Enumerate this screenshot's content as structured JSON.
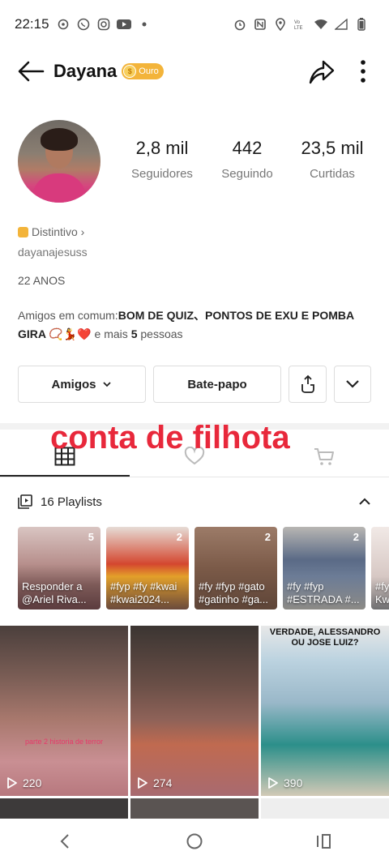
{
  "status_bar": {
    "time": "22:15"
  },
  "header": {
    "username": "Dayana",
    "badge_label": "Ouro",
    "badge_coin": "$"
  },
  "stats": [
    {
      "value": "2,8 mil",
      "label": "Seguidores"
    },
    {
      "value": "442",
      "label": "Seguindo"
    },
    {
      "value": "23,5 mil",
      "label": "Curtidas"
    }
  ],
  "profile": {
    "distintivo": "Distintivo ›",
    "handle": "dayanajesuss",
    "age": "22 ANOS",
    "mutual_prefix": "Amigos em comum:",
    "mutual_names": "BOM DE QUIZ、PONTOS  DE EXU E POMBA GIRA 📿💃❤️",
    "mutual_mid": " e mais ",
    "mutual_count": "5",
    "mutual_suffix": " pessoas"
  },
  "actions": {
    "friends_label": "Amigos",
    "chat_label": "Bate-papo"
  },
  "overlay_text": "conta de filhota",
  "playlists": {
    "label": "16 Playlists",
    "items": [
      {
        "count": "5",
        "caption": "Responder a @Ariel Riva..."
      },
      {
        "count": "2",
        "caption": "#fyp #fy #kwai #kwai2024..."
      },
      {
        "count": "2",
        "caption": "#fy #fyp #gato #gatinho #ga..."
      },
      {
        "count": "2",
        "caption": "#fy #fyp #ESTRADA #..."
      },
      {
        "count": "",
        "caption": "#fy Kw"
      }
    ]
  },
  "videos": [
    {
      "plays": "220",
      "overlay": "parte 2 historia de terror"
    },
    {
      "plays": "274",
      "overlay": ""
    },
    {
      "plays": "390",
      "overlay": "VERDADE, ALESSANDRO OU JOSE LUIZ?"
    }
  ]
}
